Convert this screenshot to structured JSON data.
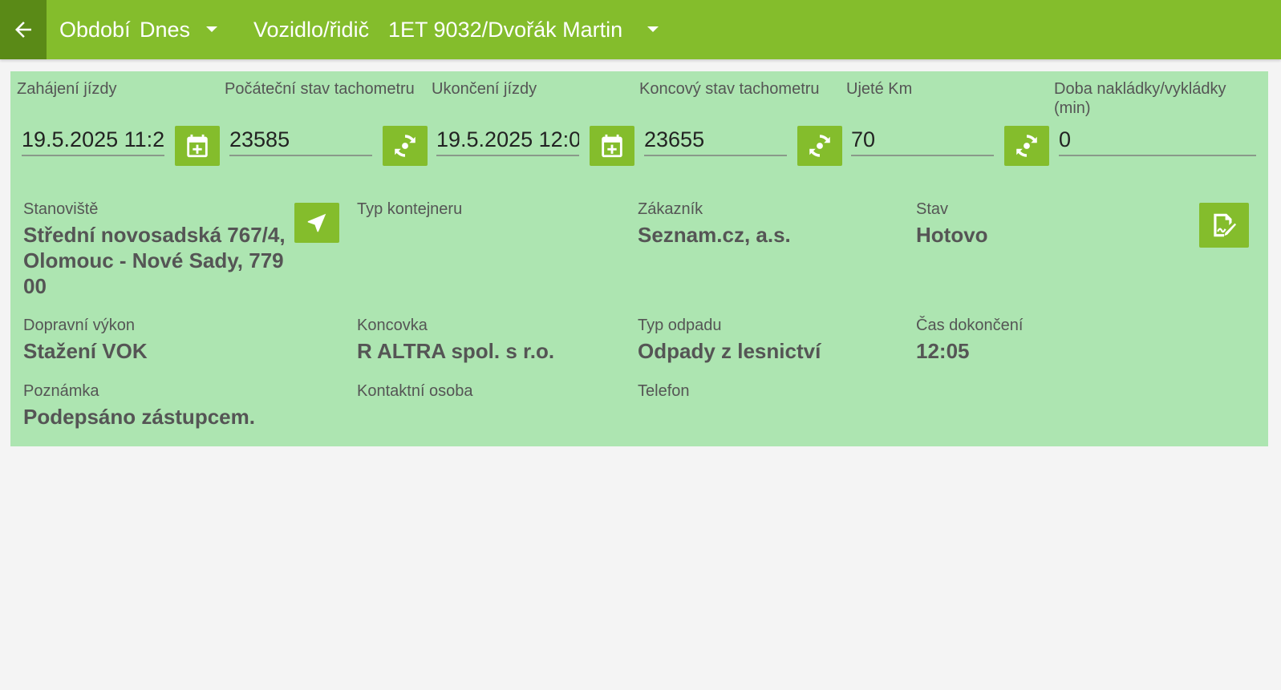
{
  "header": {
    "back_icon": "arrow-left-icon",
    "period_label": "Období",
    "period_value": "Dnes",
    "vehicle_label": "Vozidlo/řidič",
    "vehicle_value": "1ET 9032/Dvořák Martin"
  },
  "trip": {
    "start_label": "Zahájení jízdy",
    "start_value": "19.5.2025 11:2",
    "odo_start_label": "Počáteční stav tachometru",
    "odo_start_value": "23585",
    "end_label": "Ukončení jízdy",
    "end_value": "19.5.2025 12:0",
    "odo_end_label": "Koncový stav tachometru",
    "odo_end_value": "23655",
    "km_label": "Ujeté Km",
    "km_value": "70",
    "loading_label": "Doba nakládky/vykládky (min)",
    "loading_value": "0"
  },
  "details": {
    "site_label": "Stanoviště",
    "site_value": "Střední novosadská 767/4, Olomouc - Nové Sady, 779 00",
    "container_label": "Typ kontejneru",
    "container_value": "",
    "customer_label": "Zákazník",
    "customer_value": "Seznam.cz, a.s.",
    "state_label": "Stav",
    "state_value": "Hotovo",
    "transport_label": "Dopravní výkon",
    "transport_value": "Stažení VOK",
    "terminal_label": "Koncovka",
    "terminal_value": "R ALTRA spol. s r.o.",
    "waste_label": "Typ odpadu",
    "waste_value": "Odpady z lesnictví",
    "finish_label": "Čas dokončení",
    "finish_value": "12:05",
    "note_label": "Poznámka",
    "note_value": "Podepsáno zástupcem.",
    "contact_label": "Kontaktní osoba",
    "contact_value": "",
    "phone_label": "Telefon",
    "phone_value": ""
  },
  "colors": {
    "accent": "#84bd2c",
    "accent_dark": "#5a8a17",
    "panel": "#ade5b1",
    "background": "#f4f4f4"
  }
}
